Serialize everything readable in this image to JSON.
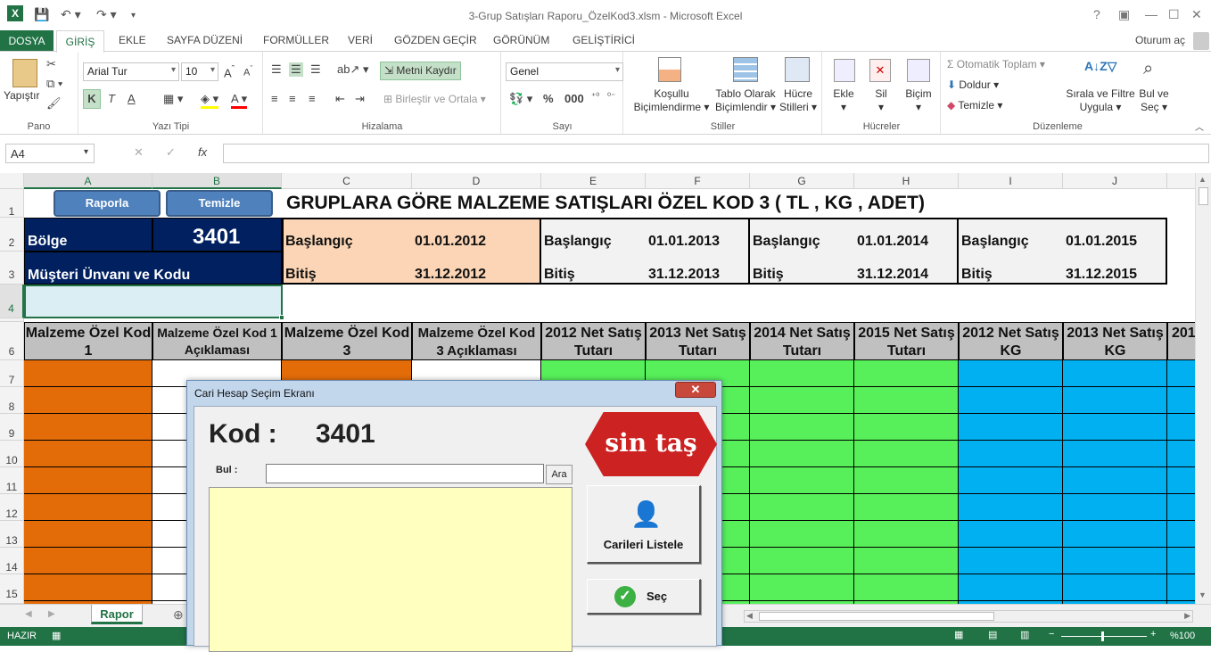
{
  "window": {
    "title": "3-Grup Satışları Raporu_ÖzelKod3.xlsm - Microsoft Excel"
  },
  "ribbon_tabs": [
    "DOSYA",
    "GİRİŞ",
    "EKLE",
    "SAYFA DÜZENİ",
    "FORMÜLLER",
    "VERİ",
    "GÖZDEN GEÇİR",
    "GÖRÜNÜM",
    "GELİŞTİRİCİ"
  ],
  "user": "Oturum aç",
  "groups": {
    "pano": "Pano",
    "yazi_tipi": "Yazı Tipi",
    "hizalama": "Hizalama",
    "sayi": "Sayı",
    "stiller": "Stiller",
    "hucreler": "Hücreler",
    "duzenleme": "Düzenleme"
  },
  "ribbon": {
    "paste": "Yapıştır",
    "font": "Arial Tur",
    "size": "10",
    "bold": "K",
    "italic": "T",
    "underline": "A",
    "wrap": "Metni Kaydır",
    "merge": "Birleştir ve Ortala",
    "numfmt": "Genel",
    "percent": "%",
    "cond1": "Koşullu",
    "cond2": "Biçimlendirme",
    "table1": "Tablo Olarak",
    "table2": "Biçimlendir",
    "cell1": "Hücre",
    "cell2": "Stilleri",
    "insert": "Ekle",
    "delete": "Sil",
    "format": "Biçim",
    "autosum": "Otomatik Toplam",
    "fill": "Doldur",
    "clear": "Temizle",
    "sort1": "Sırala ve Filtre",
    "sort2": "Uygula",
    "find1": "Bul ve",
    "find2": "Seç"
  },
  "formula": {
    "namebox": "A4",
    "fx": "fx"
  },
  "columns": [
    "A",
    "B",
    "C",
    "D",
    "E",
    "F",
    "G",
    "H",
    "I",
    "J"
  ],
  "rows": [
    "1",
    "2",
    "3",
    "4",
    "6",
    "7",
    "8",
    "9",
    "10",
    "11",
    "12",
    "13",
    "14",
    "15"
  ],
  "sheet": {
    "btn_report": "Raporla",
    "btn_clear": "Temizle",
    "title": "GRUPLARA GÖRE MALZEME SATIŞLARI ÖZEL KOD 3 ( TL , KG , ADET)",
    "region_label": "Bölge",
    "region_value": "3401",
    "customer_label": "Müşteri Ünvanı ve Kodu",
    "start_label": "Başlangıç",
    "end_label": "Bitiş",
    "periods": [
      {
        "start": "01.01.2012",
        "end": "31.12.2012"
      },
      {
        "start": "01.01.2013",
        "end": "31.12.2013"
      },
      {
        "start": "01.01.2014",
        "end": "31.12.2014"
      },
      {
        "start": "01.01.2015",
        "end": "31.12.2015"
      }
    ],
    "headers": [
      "Malzeme Özel Kod 1",
      "Malzeme Özel Kod 1 Açıklaması",
      "Malzeme Özel Kod 3",
      "Malzeme Özel Kod 3 Açıklaması",
      "2012 Net Satış Tutarı",
      "2013 Net Satış Tutarı",
      "2014 Net Satış Tutarı",
      "2015 Net Satış Tutarı",
      "2012 Net Satış KG",
      "2013 Net Satış KG",
      "201"
    ]
  },
  "colors": {
    "orange": "#e36c09",
    "green": "#57f05a",
    "blue": "#00b0f0",
    "navy": "#002060",
    "peach": "#fbd5b5",
    "excel_green": "#217346"
  },
  "sheet_tab": "Rapor",
  "status": {
    "mode": "HAZIR",
    "zoom": "%100"
  },
  "dialog": {
    "title": "Cari Hesap Seçim Ekranı",
    "kod_label": "Kod :",
    "kod_value": "3401",
    "find_label": "Bul :",
    "find_btn": "Ara",
    "list_btn": "Carileri Listele",
    "select_btn": "Seç",
    "logo": "sin taş"
  }
}
